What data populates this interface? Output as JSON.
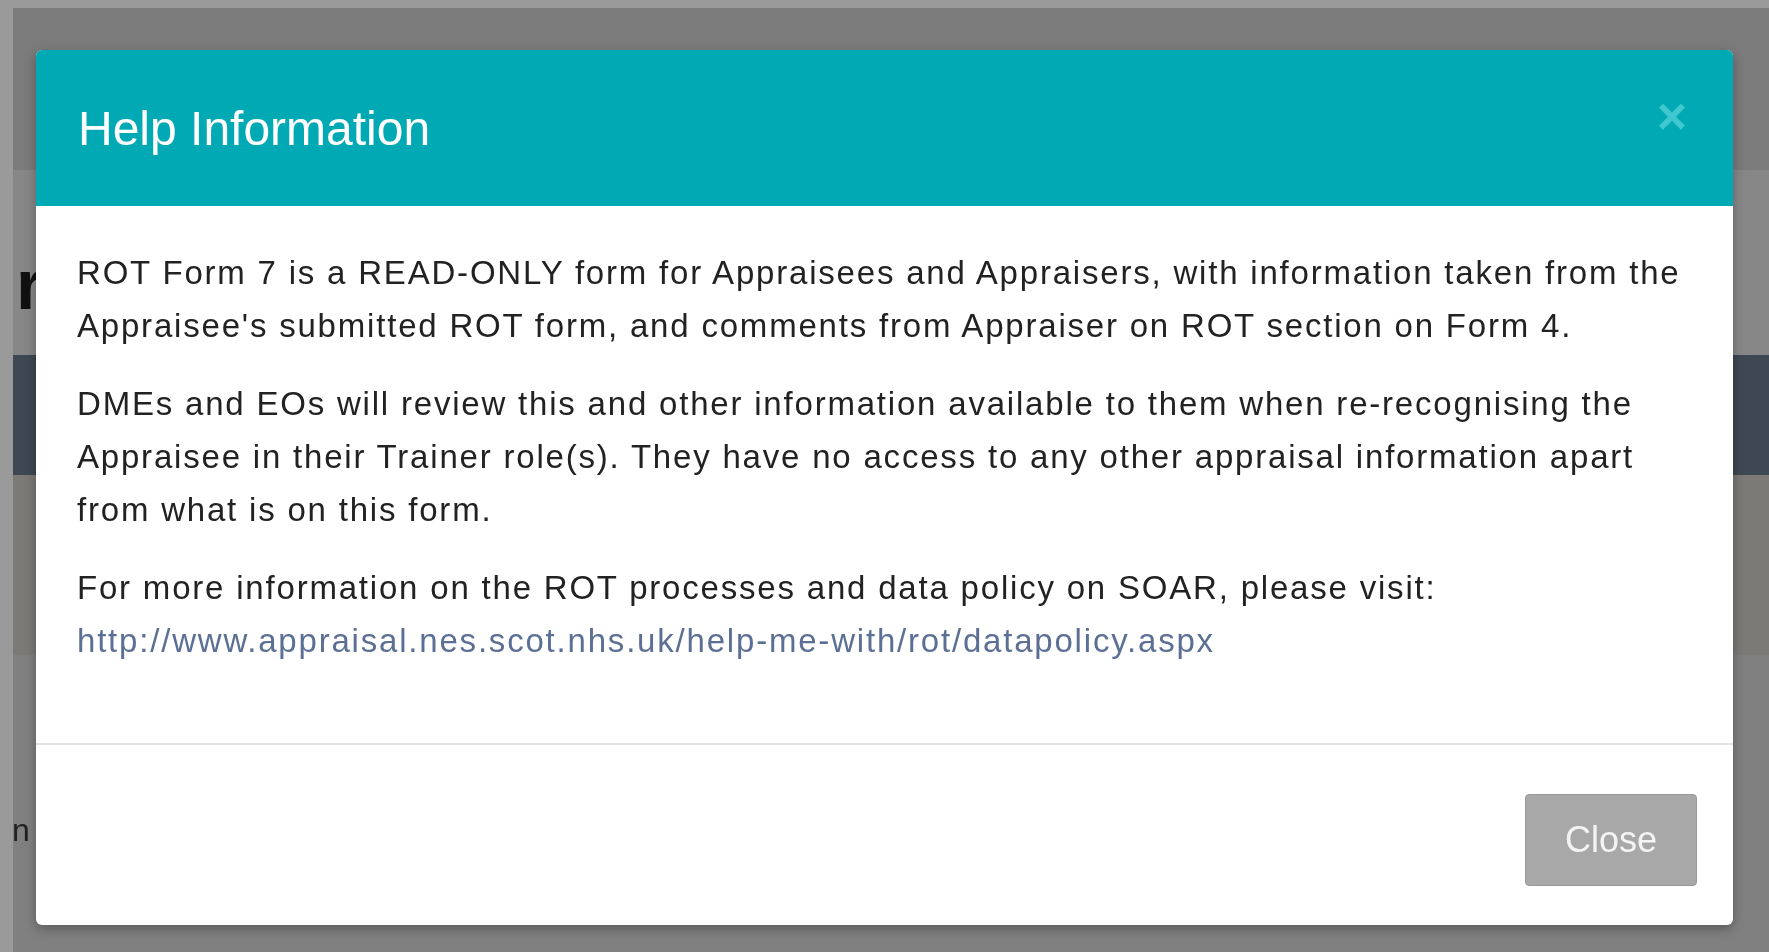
{
  "background": {
    "fragments": [
      {
        "text": "r",
        "kind": "heading"
      },
      {
        "text": "n",
        "kind": "text"
      }
    ]
  },
  "dialog": {
    "title": "Help Information",
    "close_icon": "×",
    "paragraphs": [
      "ROT Form 7 is a READ-ONLY form for Appraisees and Appraisers, with information taken from the Appraisee's submitted ROT form, and comments from Appraiser on ROT section on Form 4.",
      "DMEs and EOs will review this and other information available to them when re-recognising the Appraisee in their Trainer role(s). They have no access to any other appraisal information apart from what is on this form.",
      "For more information on the ROT processes and data policy on SOAR, please visit:"
    ],
    "link": "http://www.appraisal.nes.scot.nhs.uk/help-me-with/rot/datapolicy.aspx",
    "buttons": [
      {
        "label": "Close",
        "disabled": true
      }
    ]
  }
}
